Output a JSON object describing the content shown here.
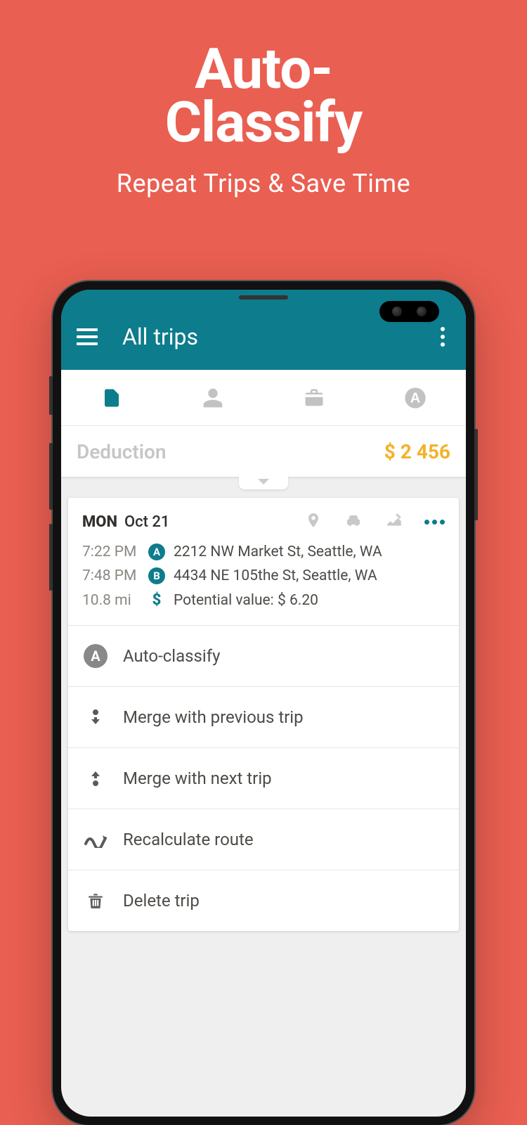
{
  "promo": {
    "title_line1": "Auto-",
    "title_line2": "Classify",
    "subtitle": "Repeat Trips & Save Time"
  },
  "header": {
    "title": "All trips"
  },
  "deduction": {
    "label": "Deduction",
    "currency": "$",
    "amount": "2 456"
  },
  "trip": {
    "day": "MON",
    "date": "Oct 21",
    "start_time": "7:22 PM",
    "start_marker": "A",
    "start_address": "2212 NW Market St, Seattle, WA",
    "end_time": "7:48 PM",
    "end_marker": "B",
    "end_address": "4434 NE 105the St, Seattle, WA",
    "distance": "10.8 mi",
    "value_label": "Potential value: $ 6.20"
  },
  "actions": {
    "auto_classify": "Auto-classify",
    "merge_prev": "Merge with previous trip",
    "merge_next": "Merge with next trip",
    "recalculate": "Recalculate route",
    "delete": "Delete trip"
  }
}
